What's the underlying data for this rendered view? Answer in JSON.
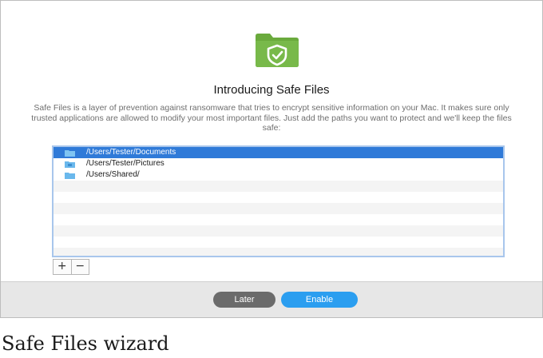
{
  "dialog": {
    "title": "Introducing Safe Files",
    "description": "Safe Files is a layer of prevention against ransomware that tries to encrypt sensitive information on your Mac. It makes sure only trusted applications are allowed to modify your most important files. Just add the paths you want to protect and we'll keep the files safe:",
    "hero_icon": "folder-shield-icon",
    "accent_color": "#6aaa3c"
  },
  "paths": [
    {
      "path": "/Users/Tester/Documents",
      "selected": true,
      "icon": "folder-icon"
    },
    {
      "path": "/Users/Tester/Pictures",
      "selected": false,
      "icon": "folder-icon"
    },
    {
      "path": "/Users/Shared/",
      "selected": false,
      "icon": "folder-icon"
    }
  ],
  "stepper": {
    "add_label": "+",
    "remove_label": "−"
  },
  "footer": {
    "later_label": "Later",
    "enable_label": "Enable",
    "later_color": "#6b6b6b",
    "enable_color": "#2b9ef0"
  },
  "caption": "Safe Files wizard"
}
